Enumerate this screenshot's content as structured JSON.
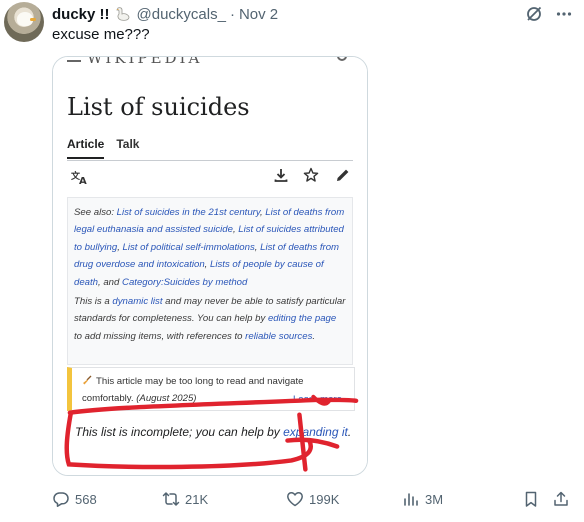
{
  "author": {
    "display_name": "ducky !!",
    "handle": "@duckycals_",
    "separator": "·",
    "date": "Nov 2",
    "avatar_icon": "duck-avatar"
  },
  "tweet": {
    "text": "excuse me???"
  },
  "screenshot": {
    "page_title": "List of suicides",
    "tabs": [
      "Article",
      "Talk"
    ],
    "tools": [
      "translate-icon",
      "download-icon",
      "star-icon",
      "edit-icon"
    ],
    "hatnote": {
      "lead": "See also: ",
      "links": [
        "List of suicides in the 21st century",
        "List of deaths from legal euthanasia and assisted suicide",
        "List of suicides attributed to bullying",
        "List of political self-immolations",
        "List of deaths from drug overdose and intoxication",
        "Lists of people by cause of death"
      ],
      "and_text": ", and ",
      "category_link": "Category:Suicides by method",
      "dynamic_pre": "This is a ",
      "dynamic_link": "dynamic list",
      "dynamic_mid": " and may never be able to satisfy particular standards for completeness. You can help by ",
      "editing_link": "editing the page",
      "dynamic_post": " to add missing items, with references to ",
      "reliable_link": "reliable sources",
      "period": "."
    },
    "ambox": {
      "text": "This article may be too long to read and navigate comfortably.",
      "date_note": "(August 2025)",
      "learn_more": "Learn more"
    },
    "incomplete": {
      "text": "This list is incomplete; you can help by ",
      "link": "expanding it",
      "period": "."
    },
    "annotation_color": "#e0232e"
  },
  "engagement": {
    "replies": "568",
    "reposts": "21K",
    "likes": "199K",
    "views": "3M"
  },
  "colors": {
    "link": "#2a56b8",
    "muted": "#536471",
    "ambox_accent": "#f3c43d"
  }
}
